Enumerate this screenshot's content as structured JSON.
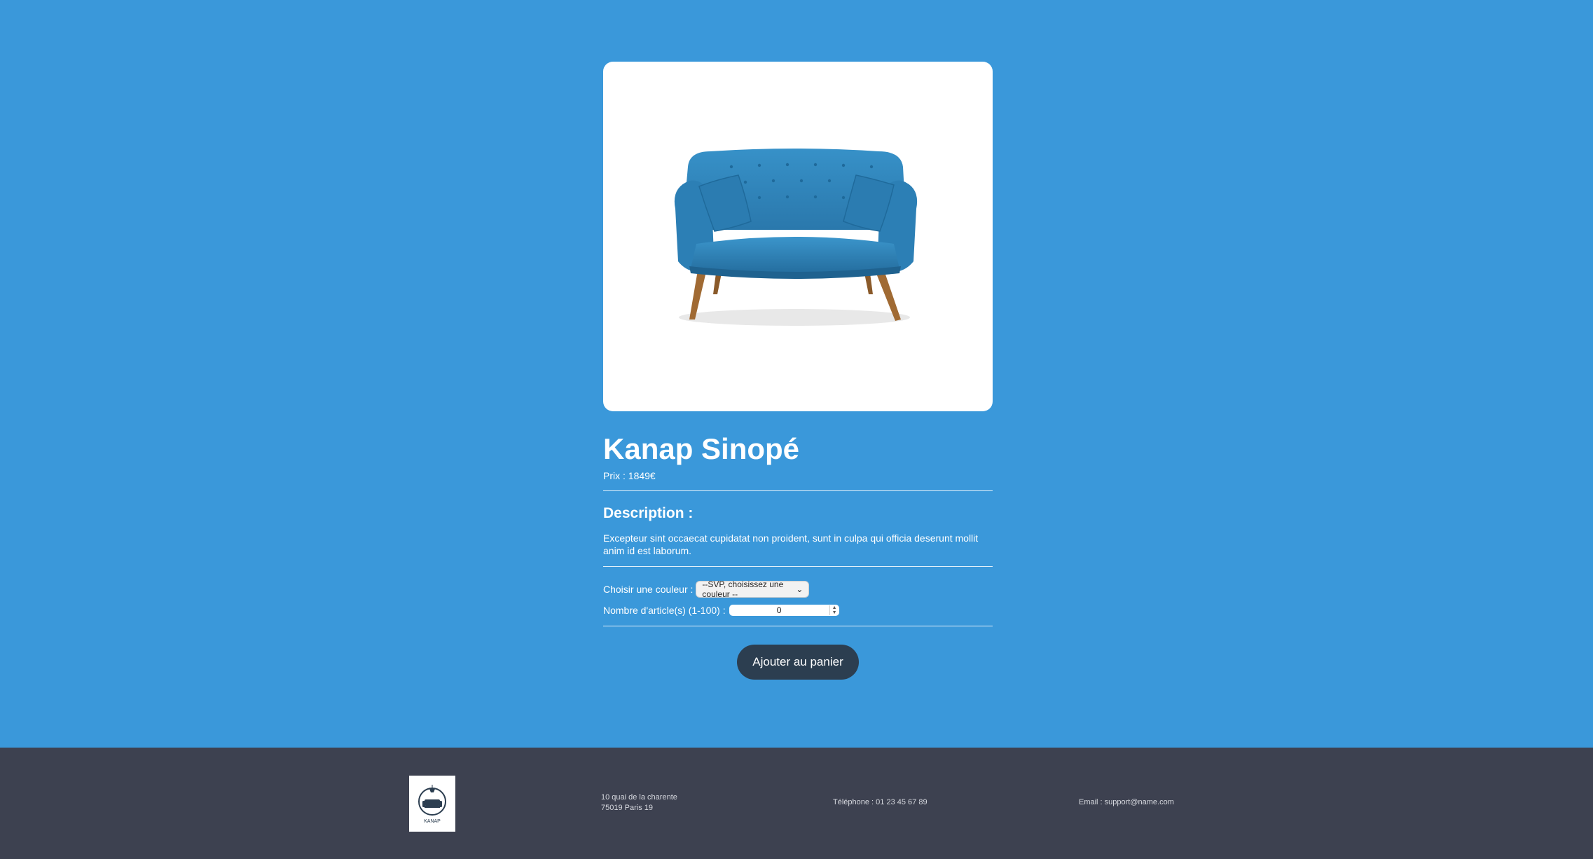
{
  "product": {
    "title": "Kanap Sinopé",
    "price": "Prix : 1849€",
    "description_title": "Description :",
    "description": "Excepteur sint occaecat cupidatat non proident, sunt in culpa qui officia deserunt mollit anim id est laborum.",
    "image_icon": "sofa-image"
  },
  "options": {
    "color_label": "Choisir une couleur :",
    "color_selected": "--SVP, choisissez une couleur --",
    "qty_label": "Nombre d'article(s) (1-100) :",
    "qty_value": "0"
  },
  "cart": {
    "add_label": "Ajouter au panier"
  },
  "footer": {
    "logo_text": "KANAP",
    "address_line1": "10 quai de la charente",
    "address_line2": "75019 Paris 19",
    "phone": "Téléphone : 01 23 45 67 89",
    "email": "Email : support@name.com"
  },
  "colors": {
    "background": "#3a98da",
    "footer": "#3d4150",
    "button": "#2c3e50",
    "sofa": "#2f82b8"
  }
}
